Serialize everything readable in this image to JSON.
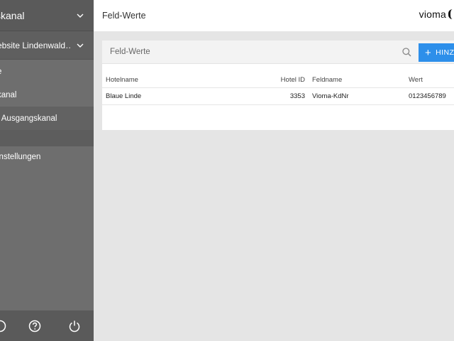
{
  "sidebar": {
    "header_label": "skanal",
    "selected_website": "ebsite Lindenwald…",
    "items": [
      {
        "label": "e"
      },
      {
        "label": "kanal"
      },
      {
        "label": "f Ausgangskanal"
      },
      {
        "label": "instellungen"
      }
    ],
    "footer_icons": [
      "settings-icon",
      "help-icon",
      "power-icon"
    ]
  },
  "topbar": {
    "title": "Feld-Werte",
    "logo": "vioma"
  },
  "card": {
    "search_label": "Feld-Werte",
    "add_button_label": "HINZU",
    "columns": [
      "Hotelname",
      "Hotel ID",
      "Feldname",
      "Wert"
    ],
    "rows": [
      {
        "hotelname": "Blaue Linde",
        "hotel_id": "3353",
        "feldname": "Vioma-KdNr",
        "wert": "0123456789"
      }
    ]
  },
  "colors": {
    "sidebar_bg": "#6e6e6e",
    "accent": "#2d8fea",
    "page_bg": "#e5e5e5"
  }
}
